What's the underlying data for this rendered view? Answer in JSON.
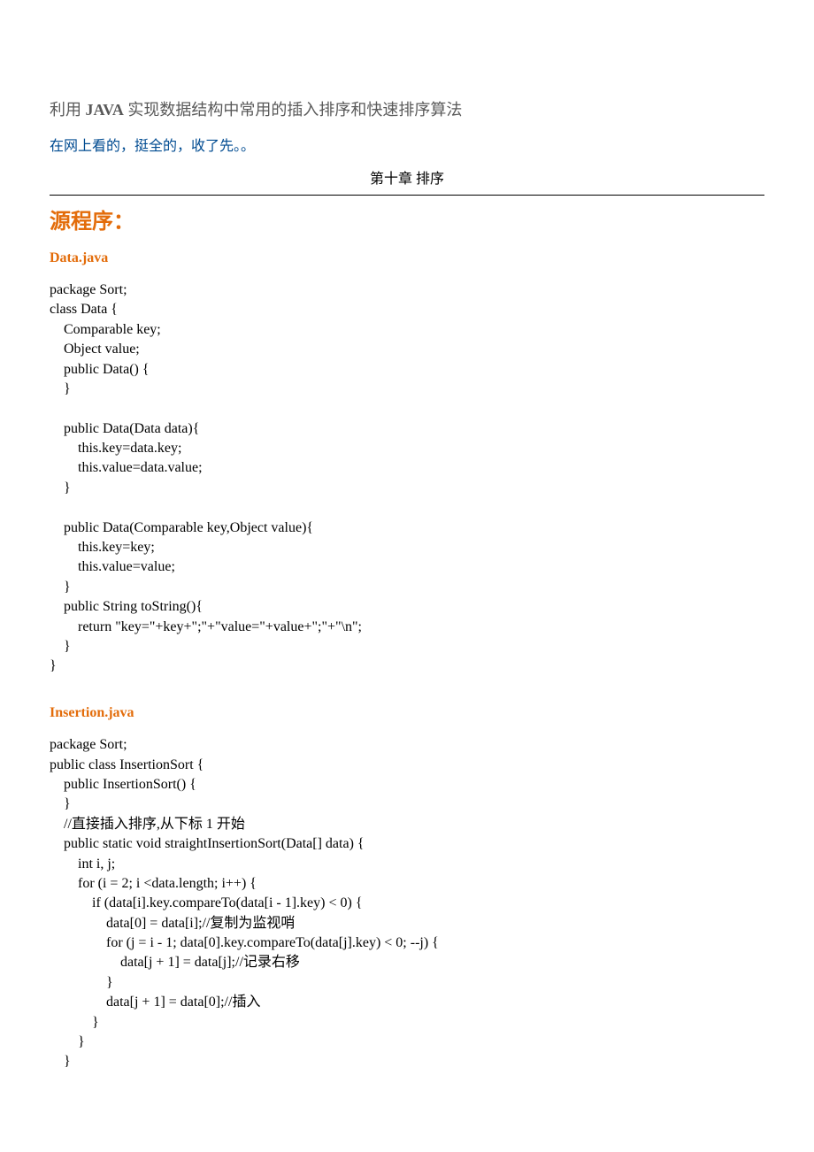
{
  "title": {
    "prefix": "利用 ",
    "bold": "JAVA",
    "suffix": " 实现数据结构中常用的插入排序和快速排序算法"
  },
  "note": "在网上看的，挺全的，收了先。。",
  "chapterTitle": "第十章  排序",
  "sectionHeading": "源程序：",
  "files": [
    {
      "name": "Data.java",
      "code": "package Sort;\nclass Data {\n    Comparable key;\n    Object value;\n    public Data() {\n    }\n\n    public Data(Data data){\n        this.key=data.key;\n        this.value=data.value;\n    }\n\n    public Data(Comparable key,Object value){\n        this.key=key;\n        this.value=value;\n    }\n    public String toString(){\n        return \"key=\"+key+\";\"+\"value=\"+value+\";\"+\"\\n\";\n    }\n}"
    },
    {
      "name": "Insertion.java",
      "code": "package Sort;\npublic class InsertionSort {\n    public InsertionSort() {\n    }\n    //直接插入排序,从下标 1 开始\n    public static void straightInsertionSort(Data[] data) {\n        int i, j;\n        for (i = 2; i <data.length; i++) {\n            if (data[i].key.compareTo(data[i - 1].key) < 0) {\n                data[0] = data[i];//复制为监视哨\n                for (j = i - 1; data[0].key.compareTo(data[j].key) < 0; --j) {\n                    data[j + 1] = data[j];//记录右移\n                }\n                data[j + 1] = data[0];//插入\n            }\n        }\n    }"
    }
  ]
}
